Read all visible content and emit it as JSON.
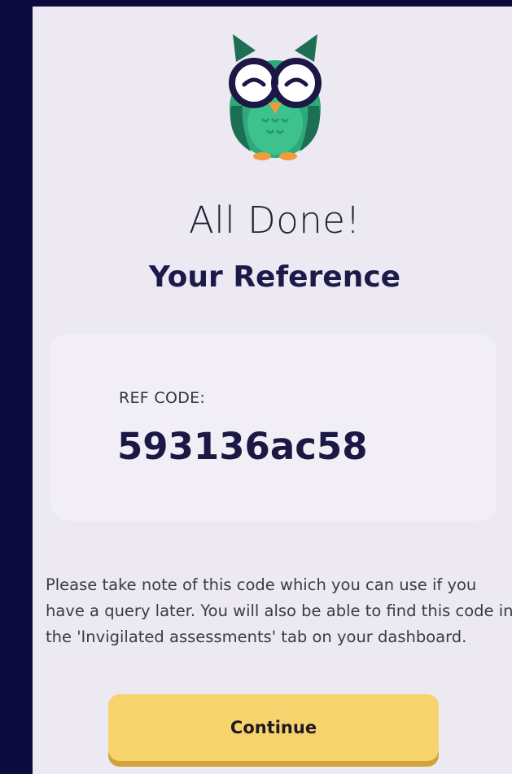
{
  "header": {
    "mascot_icon": "owl-icon",
    "title": "All Done!",
    "subtitle": "Your Reference"
  },
  "reference": {
    "label": "REF CODE:",
    "code": "593136ac58"
  },
  "note": {
    "text": "Please take note of this code which you can use if you have a query later. You will also be able to find this code in the 'Invigilated assessments' tab on your dashboard."
  },
  "actions": {
    "continue_label": "Continue"
  },
  "colors": {
    "page_background": "#0d0a3e",
    "panel_background": "#ece9f2",
    "card_background": "#f1eff5",
    "heading_text": "#1c1a4a",
    "button_fill": "#f7d36d",
    "button_shadow": "#d2a338",
    "owl_body": "#2ea97a",
    "owl_dark": "#1d6f54",
    "owl_beak": "#f29b3b"
  }
}
